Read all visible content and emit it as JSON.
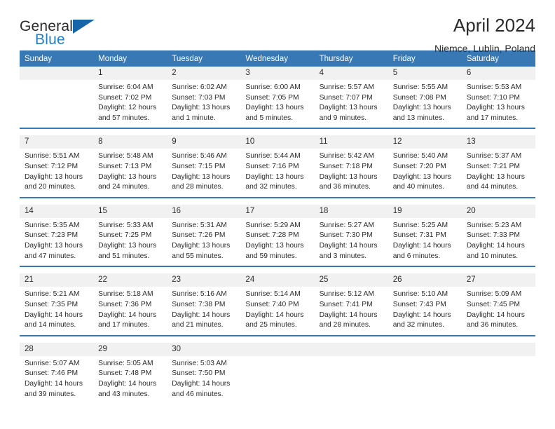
{
  "brand": {
    "name_part1": "General",
    "name_part2": "Blue",
    "accent_color": "#1f7fc4",
    "triangle_color": "#1565a8"
  },
  "header": {
    "title": "April 2024",
    "subtitle": "Niemce, Lublin, Poland"
  },
  "calendar": {
    "header_bg": "#3778b5",
    "daynum_bg": "#f1f1f1",
    "weekdays": [
      "Sunday",
      "Monday",
      "Tuesday",
      "Wednesday",
      "Thursday",
      "Friday",
      "Saturday"
    ],
    "weeks": [
      [
        {
          "day": "",
          "l1": "",
          "l2": "",
          "l3": "",
          "l4": ""
        },
        {
          "day": "1",
          "l1": "Sunrise: 6:04 AM",
          "l2": "Sunset: 7:02 PM",
          "l3": "Daylight: 12 hours",
          "l4": "and 57 minutes."
        },
        {
          "day": "2",
          "l1": "Sunrise: 6:02 AM",
          "l2": "Sunset: 7:03 PM",
          "l3": "Daylight: 13 hours",
          "l4": "and 1 minute."
        },
        {
          "day": "3",
          "l1": "Sunrise: 6:00 AM",
          "l2": "Sunset: 7:05 PM",
          "l3": "Daylight: 13 hours",
          "l4": "and 5 minutes."
        },
        {
          "day": "4",
          "l1": "Sunrise: 5:57 AM",
          "l2": "Sunset: 7:07 PM",
          "l3": "Daylight: 13 hours",
          "l4": "and 9 minutes."
        },
        {
          "day": "5",
          "l1": "Sunrise: 5:55 AM",
          "l2": "Sunset: 7:08 PM",
          "l3": "Daylight: 13 hours",
          "l4": "and 13 minutes."
        },
        {
          "day": "6",
          "l1": "Sunrise: 5:53 AM",
          "l2": "Sunset: 7:10 PM",
          "l3": "Daylight: 13 hours",
          "l4": "and 17 minutes."
        }
      ],
      [
        {
          "day": "7",
          "l1": "Sunrise: 5:51 AM",
          "l2": "Sunset: 7:12 PM",
          "l3": "Daylight: 13 hours",
          "l4": "and 20 minutes."
        },
        {
          "day": "8",
          "l1": "Sunrise: 5:48 AM",
          "l2": "Sunset: 7:13 PM",
          "l3": "Daylight: 13 hours",
          "l4": "and 24 minutes."
        },
        {
          "day": "9",
          "l1": "Sunrise: 5:46 AM",
          "l2": "Sunset: 7:15 PM",
          "l3": "Daylight: 13 hours",
          "l4": "and 28 minutes."
        },
        {
          "day": "10",
          "l1": "Sunrise: 5:44 AM",
          "l2": "Sunset: 7:16 PM",
          "l3": "Daylight: 13 hours",
          "l4": "and 32 minutes."
        },
        {
          "day": "11",
          "l1": "Sunrise: 5:42 AM",
          "l2": "Sunset: 7:18 PM",
          "l3": "Daylight: 13 hours",
          "l4": "and 36 minutes."
        },
        {
          "day": "12",
          "l1": "Sunrise: 5:40 AM",
          "l2": "Sunset: 7:20 PM",
          "l3": "Daylight: 13 hours",
          "l4": "and 40 minutes."
        },
        {
          "day": "13",
          "l1": "Sunrise: 5:37 AM",
          "l2": "Sunset: 7:21 PM",
          "l3": "Daylight: 13 hours",
          "l4": "and 44 minutes."
        }
      ],
      [
        {
          "day": "14",
          "l1": "Sunrise: 5:35 AM",
          "l2": "Sunset: 7:23 PM",
          "l3": "Daylight: 13 hours",
          "l4": "and 47 minutes."
        },
        {
          "day": "15",
          "l1": "Sunrise: 5:33 AM",
          "l2": "Sunset: 7:25 PM",
          "l3": "Daylight: 13 hours",
          "l4": "and 51 minutes."
        },
        {
          "day": "16",
          "l1": "Sunrise: 5:31 AM",
          "l2": "Sunset: 7:26 PM",
          "l3": "Daylight: 13 hours",
          "l4": "and 55 minutes."
        },
        {
          "day": "17",
          "l1": "Sunrise: 5:29 AM",
          "l2": "Sunset: 7:28 PM",
          "l3": "Daylight: 13 hours",
          "l4": "and 59 minutes."
        },
        {
          "day": "18",
          "l1": "Sunrise: 5:27 AM",
          "l2": "Sunset: 7:30 PM",
          "l3": "Daylight: 14 hours",
          "l4": "and 3 minutes."
        },
        {
          "day": "19",
          "l1": "Sunrise: 5:25 AM",
          "l2": "Sunset: 7:31 PM",
          "l3": "Daylight: 14 hours",
          "l4": "and 6 minutes."
        },
        {
          "day": "20",
          "l1": "Sunrise: 5:23 AM",
          "l2": "Sunset: 7:33 PM",
          "l3": "Daylight: 14 hours",
          "l4": "and 10 minutes."
        }
      ],
      [
        {
          "day": "21",
          "l1": "Sunrise: 5:21 AM",
          "l2": "Sunset: 7:35 PM",
          "l3": "Daylight: 14 hours",
          "l4": "and 14 minutes."
        },
        {
          "day": "22",
          "l1": "Sunrise: 5:18 AM",
          "l2": "Sunset: 7:36 PM",
          "l3": "Daylight: 14 hours",
          "l4": "and 17 minutes."
        },
        {
          "day": "23",
          "l1": "Sunrise: 5:16 AM",
          "l2": "Sunset: 7:38 PM",
          "l3": "Daylight: 14 hours",
          "l4": "and 21 minutes."
        },
        {
          "day": "24",
          "l1": "Sunrise: 5:14 AM",
          "l2": "Sunset: 7:40 PM",
          "l3": "Daylight: 14 hours",
          "l4": "and 25 minutes."
        },
        {
          "day": "25",
          "l1": "Sunrise: 5:12 AM",
          "l2": "Sunset: 7:41 PM",
          "l3": "Daylight: 14 hours",
          "l4": "and 28 minutes."
        },
        {
          "day": "26",
          "l1": "Sunrise: 5:10 AM",
          "l2": "Sunset: 7:43 PM",
          "l3": "Daylight: 14 hours",
          "l4": "and 32 minutes."
        },
        {
          "day": "27",
          "l1": "Sunrise: 5:09 AM",
          "l2": "Sunset: 7:45 PM",
          "l3": "Daylight: 14 hours",
          "l4": "and 36 minutes."
        }
      ],
      [
        {
          "day": "28",
          "l1": "Sunrise: 5:07 AM",
          "l2": "Sunset: 7:46 PM",
          "l3": "Daylight: 14 hours",
          "l4": "and 39 minutes."
        },
        {
          "day": "29",
          "l1": "Sunrise: 5:05 AM",
          "l2": "Sunset: 7:48 PM",
          "l3": "Daylight: 14 hours",
          "l4": "and 43 minutes."
        },
        {
          "day": "30",
          "l1": "Sunrise: 5:03 AM",
          "l2": "Sunset: 7:50 PM",
          "l3": "Daylight: 14 hours",
          "l4": "and 46 minutes."
        },
        {
          "day": "",
          "l1": "",
          "l2": "",
          "l3": "",
          "l4": ""
        },
        {
          "day": "",
          "l1": "",
          "l2": "",
          "l3": "",
          "l4": ""
        },
        {
          "day": "",
          "l1": "",
          "l2": "",
          "l3": "",
          "l4": ""
        },
        {
          "day": "",
          "l1": "",
          "l2": "",
          "l3": "",
          "l4": ""
        }
      ]
    ]
  }
}
